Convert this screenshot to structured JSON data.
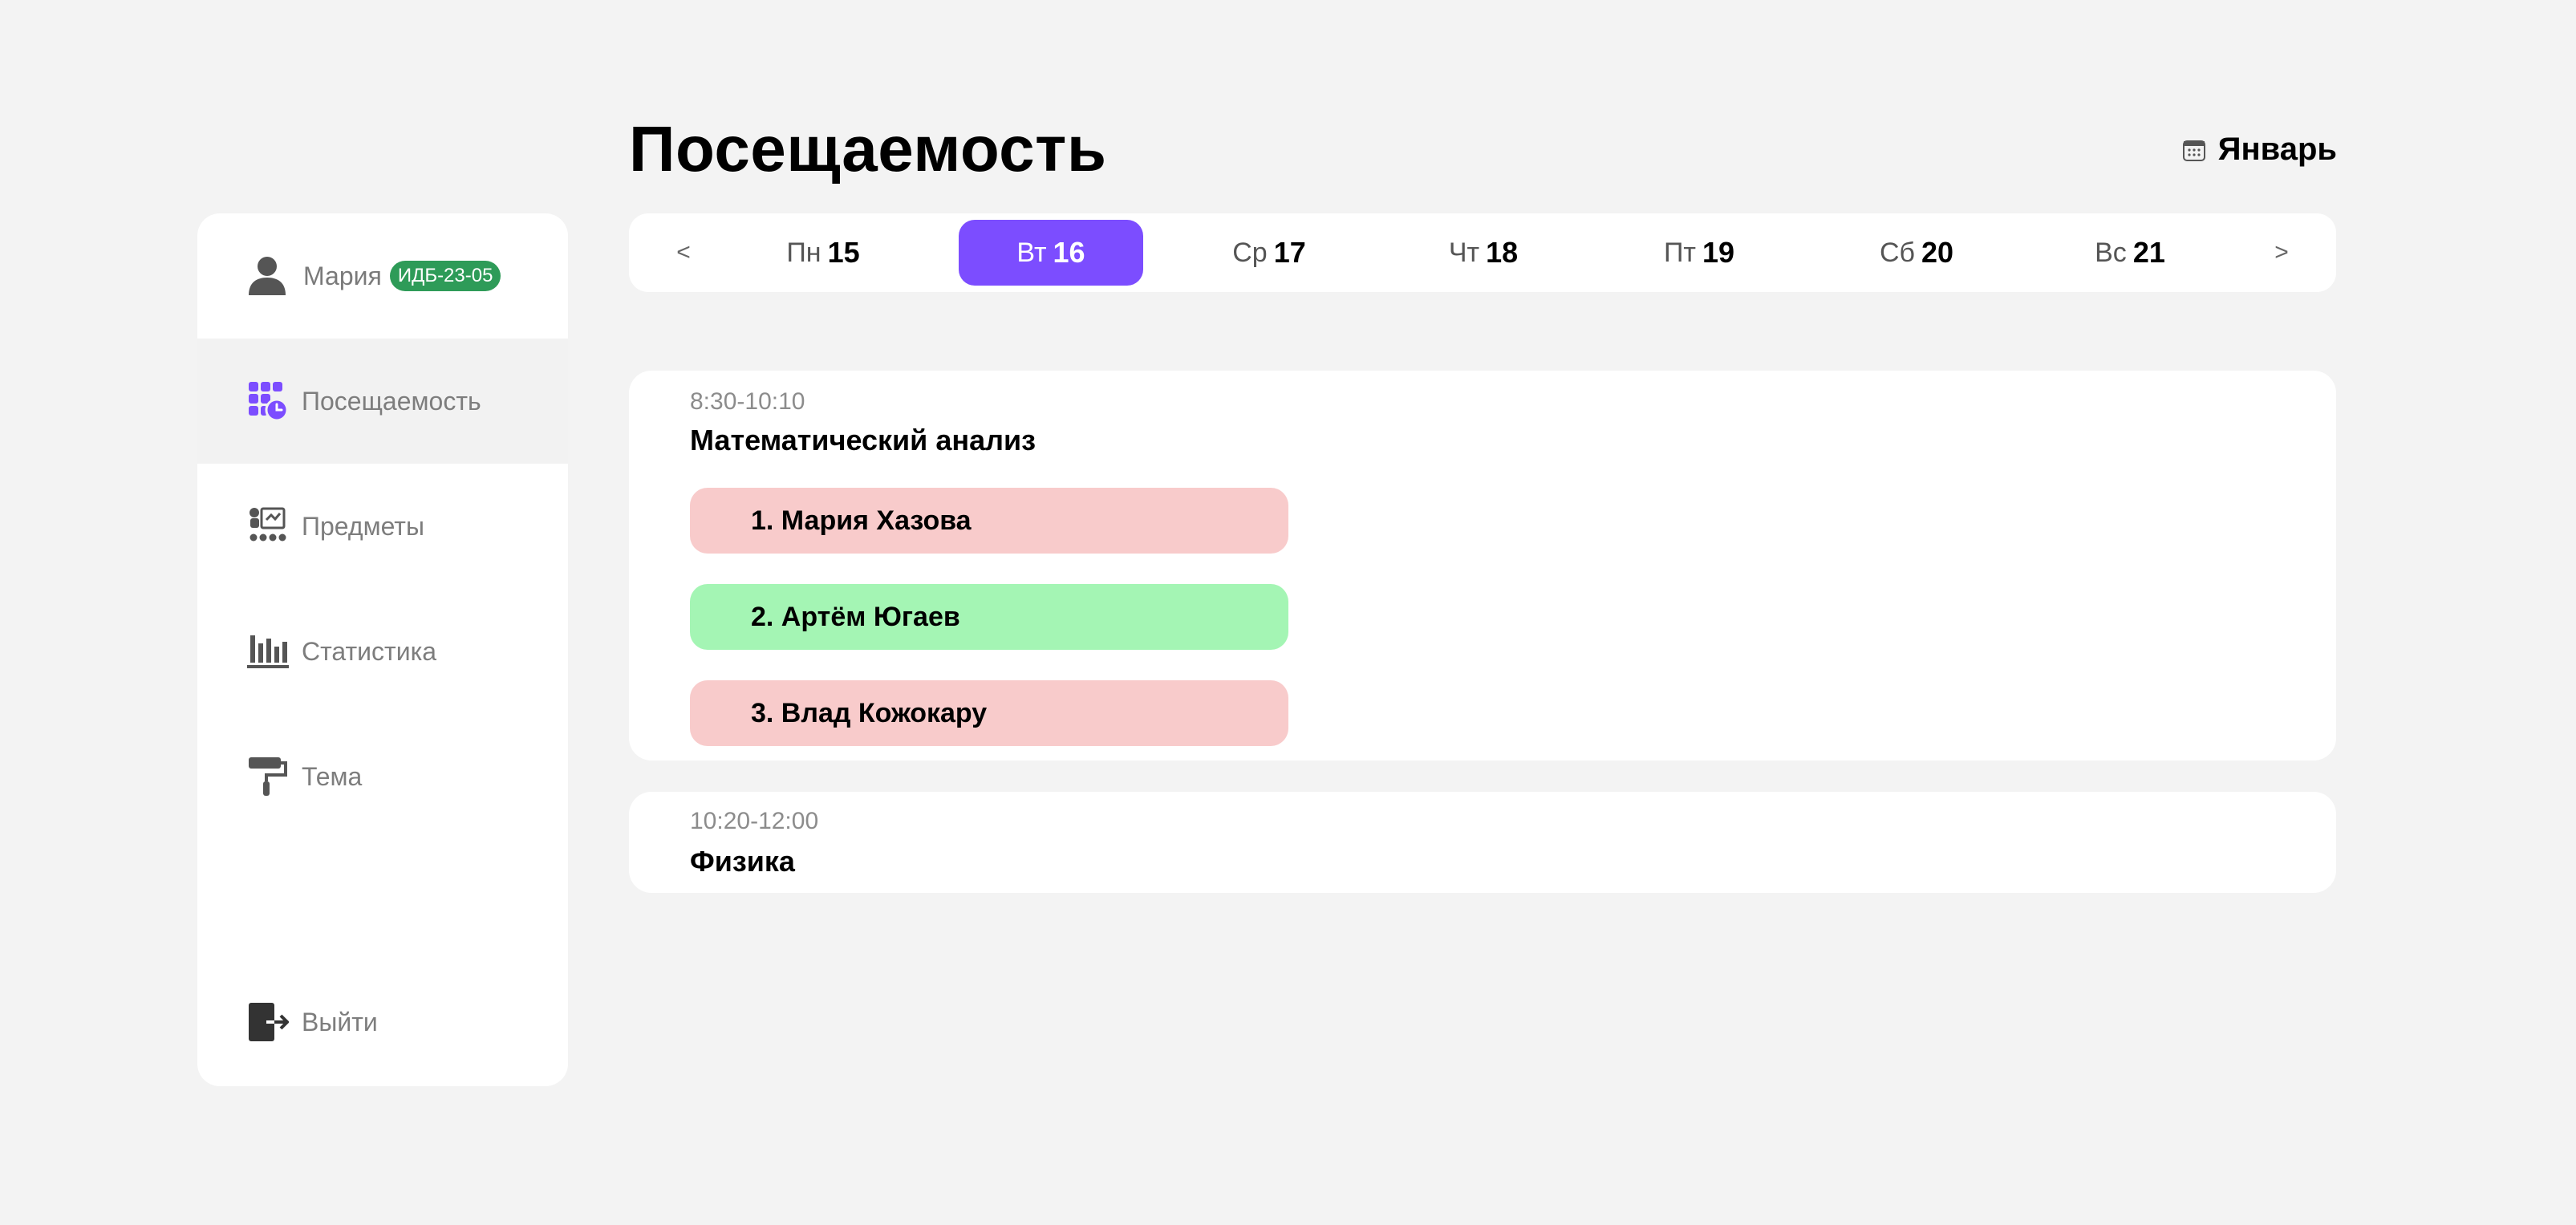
{
  "header": {
    "title": "Посещаемость",
    "month": "Январь",
    "calendar_icon": "calendar-icon"
  },
  "sidebar": {
    "user": {
      "name": "Мария",
      "group": "ИДБ-23-05",
      "group_color": "#2e9b58",
      "icon": "user-icon"
    },
    "items": [
      {
        "label": "Посещаемость",
        "icon": "attendance-icon",
        "active": true
      },
      {
        "label": "Предметы",
        "icon": "subjects-icon",
        "active": false
      },
      {
        "label": "Статистика",
        "icon": "bar-chart-icon",
        "active": false
      },
      {
        "label": "Тема",
        "icon": "paint-roller-icon",
        "active": false
      }
    ],
    "logout": {
      "label": "Выйти",
      "icon": "logout-icon"
    }
  },
  "week": {
    "prev": "<",
    "next": ">",
    "days": [
      {
        "name": "Пн",
        "num": "15",
        "active": false
      },
      {
        "name": "Вт",
        "num": "16",
        "active": true
      },
      {
        "name": "Ср",
        "num": "17",
        "active": false
      },
      {
        "name": "Чт",
        "num": "18",
        "active": false
      },
      {
        "name": "Пт",
        "num": "19",
        "active": false
      },
      {
        "name": "Сб",
        "num": "20",
        "active": false
      },
      {
        "name": "Вс",
        "num": "21",
        "active": false
      }
    ]
  },
  "lessons": [
    {
      "time": "8:30-10:10",
      "subject": "Математический анализ",
      "students": [
        {
          "label": "1. Мария Хазова",
          "status": "absent"
        },
        {
          "label": "2. Артём Югаев",
          "status": "present"
        },
        {
          "label": "3. Влад Кожокару",
          "status": "absent"
        }
      ]
    },
    {
      "time": "10:20-12:00",
      "subject": "Физика",
      "students": []
    }
  ],
  "colors": {
    "accent": "#7c4dff",
    "absent": "#f8cbcb",
    "present": "#a4f5b4",
    "background": "#f3f3f3"
  }
}
